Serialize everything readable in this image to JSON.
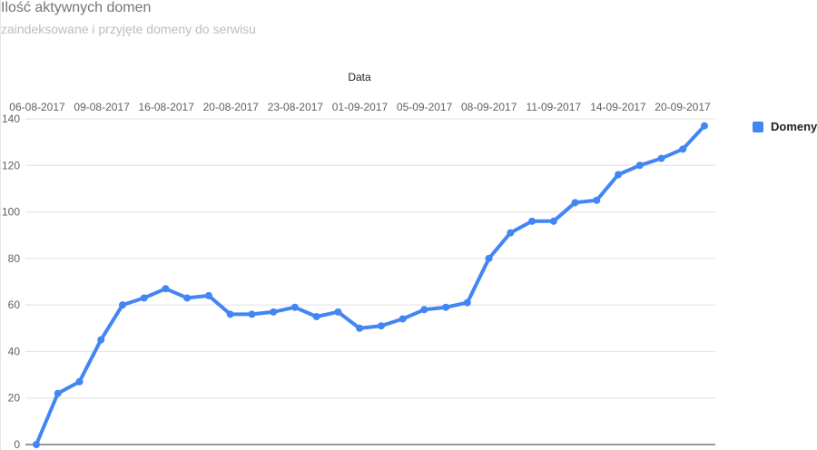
{
  "header": {
    "title": "Ilość aktywnych domen",
    "subtitle": "zaindeksowane i przyjęte domeny do serwisu"
  },
  "legend": {
    "label": "Domeny"
  },
  "colors": {
    "series": "#4285f4",
    "grid": "#e0e0e0",
    "axis": "#333333",
    "tick_text": "#616161"
  },
  "chart_data": {
    "type": "line",
    "xlabel": "Data",
    "ylabel": "",
    "x_axis_position": "top",
    "legend_position": "right",
    "grid": true,
    "ylim": [
      0,
      140
    ],
    "yticks": [
      0,
      20,
      40,
      60,
      80,
      100,
      120,
      140
    ],
    "xtick_labels": [
      "06-08-2017",
      "09-08-2017",
      "16-08-2017",
      "20-08-2017",
      "23-08-2017",
      "01-09-2017",
      "05-09-2017",
      "08-09-2017",
      "11-09-2017",
      "14-09-2017",
      "20-09-2017"
    ],
    "series": [
      {
        "name": "Domeny",
        "values": [
          0,
          22,
          27,
          45,
          60,
          63,
          67,
          63,
          64,
          56,
          56,
          57,
          59,
          55,
          57,
          50,
          51,
          54,
          58,
          59,
          61,
          80,
          91,
          96,
          96,
          104,
          105,
          116,
          120,
          123,
          127,
          137
        ]
      }
    ]
  }
}
